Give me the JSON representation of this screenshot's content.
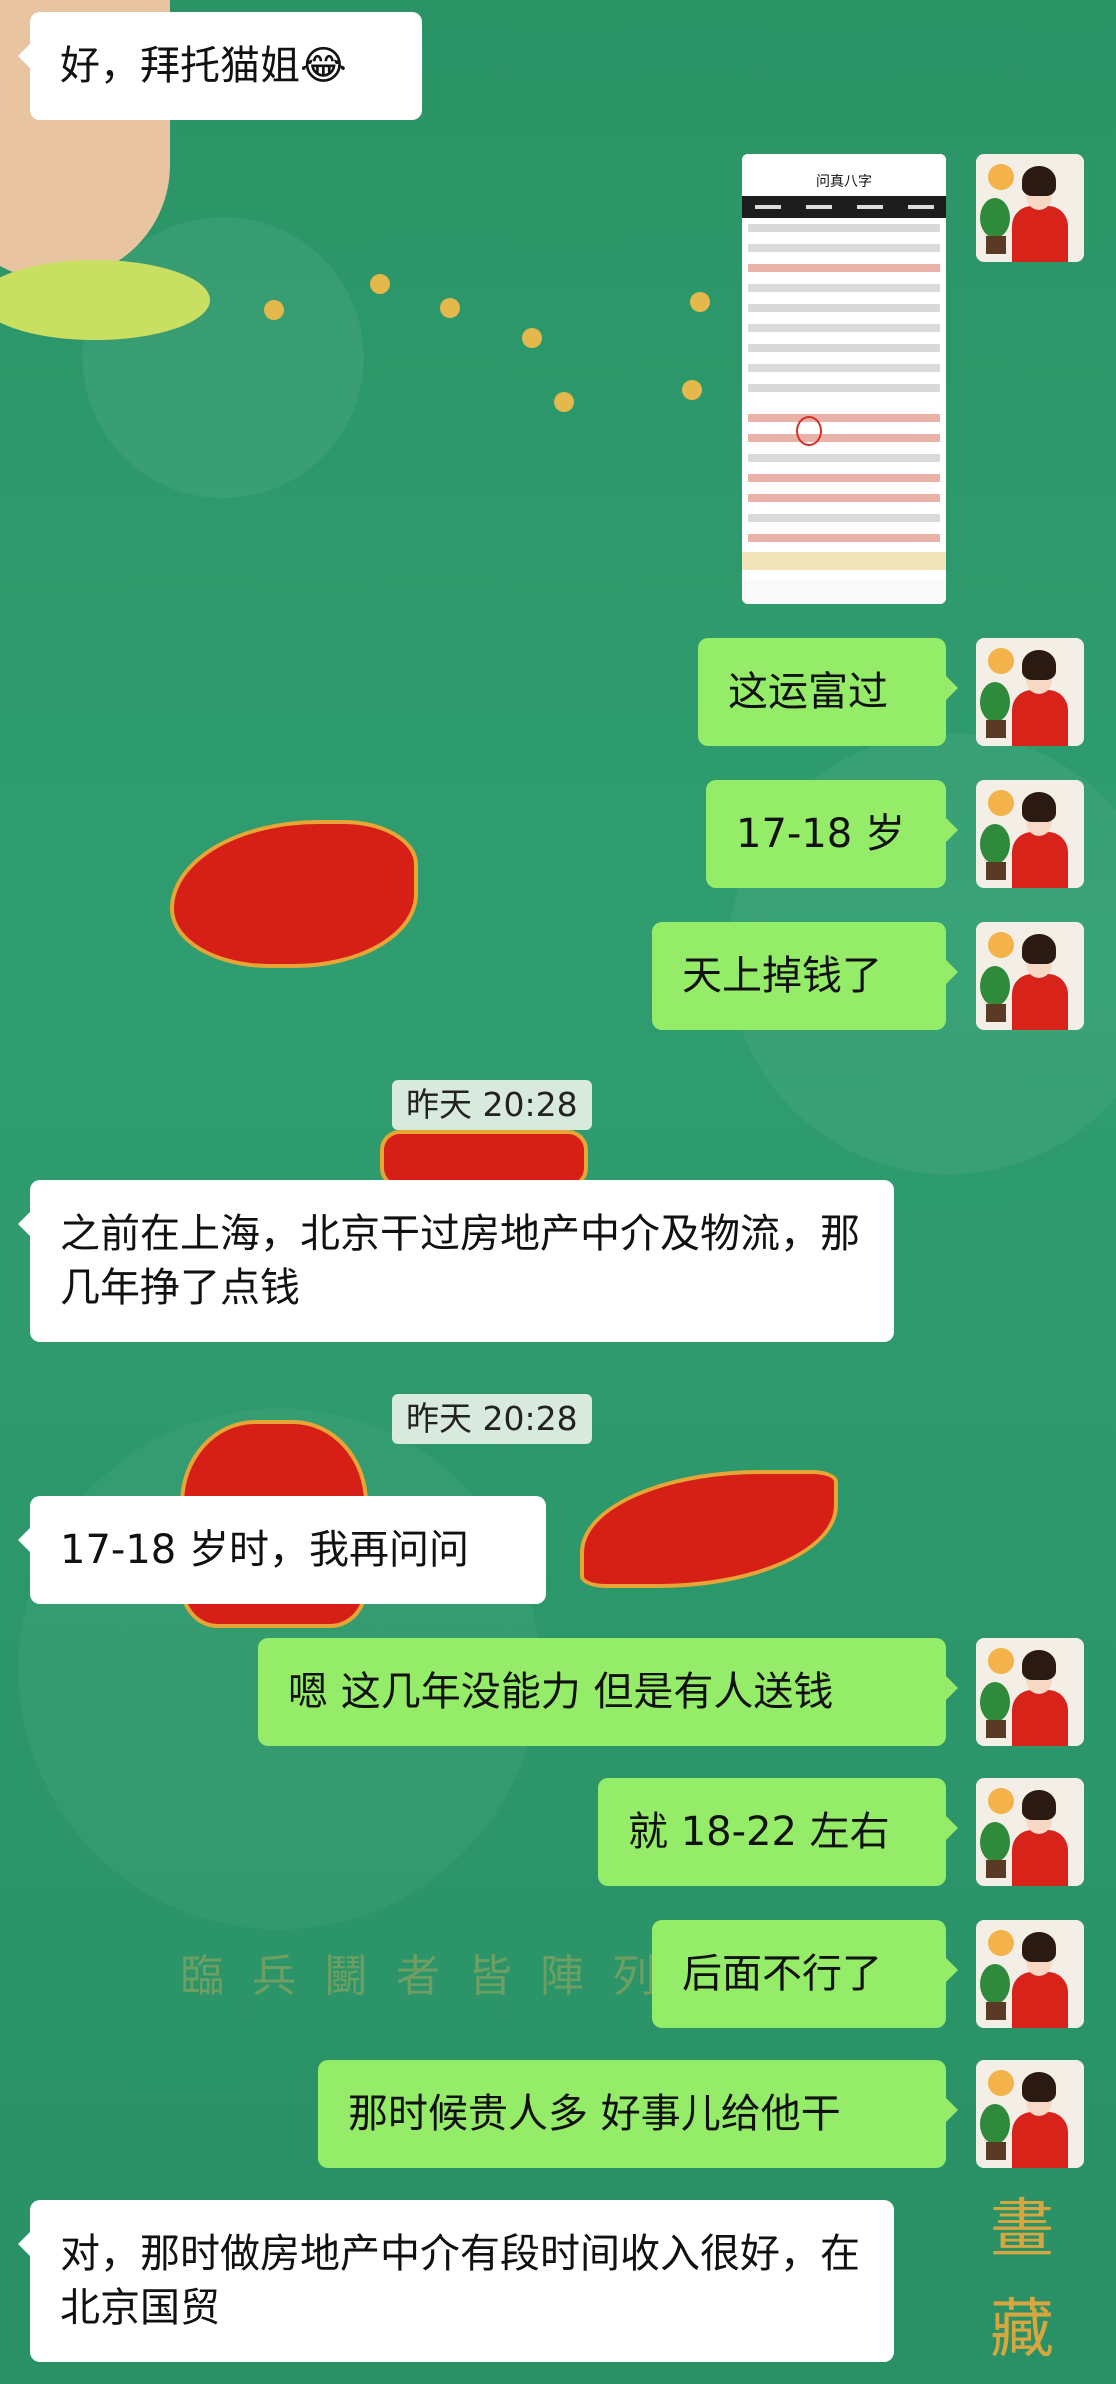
{
  "background": {
    "seal_text": "畫藏",
    "gold_text": "臨兵鬭者皆陣列",
    "colors": {
      "chat_bg": "#2f9a6b",
      "bubble_in": "#ffffff",
      "bubble_out": "#95ec69",
      "timestamp_bg": "#d8e9dd"
    }
  },
  "screenshot_preview": {
    "title": "问真八字",
    "icon": "bazi-chart-screenshot"
  },
  "timestamps": [
    "昨天 20:28",
    "昨天 20:28"
  ],
  "messages": [
    {
      "side": "left",
      "text": "好，拜托猫姐😂"
    },
    {
      "side": "right",
      "type": "image",
      "text": ""
    },
    {
      "side": "right",
      "text": "这运富过"
    },
    {
      "side": "right",
      "text": "17-18 岁"
    },
    {
      "side": "right",
      "text": "天上掉钱了"
    },
    {
      "side": "left",
      "text": "之前在上海，北京干过房地产中介及物流，那几年挣了点钱"
    },
    {
      "side": "left",
      "text": "17-18 岁时，我再问问"
    },
    {
      "side": "right",
      "text": "嗯 这几年没能力 但是有人送钱"
    },
    {
      "side": "right",
      "text": "就 18-22 左右"
    },
    {
      "side": "right",
      "text": "后面不行了"
    },
    {
      "side": "right",
      "text": "那时候贵人多 好事儿给他干"
    },
    {
      "side": "left",
      "text": "对，那时做房地产中介有段时间收入很好，在北京国贸"
    }
  ]
}
